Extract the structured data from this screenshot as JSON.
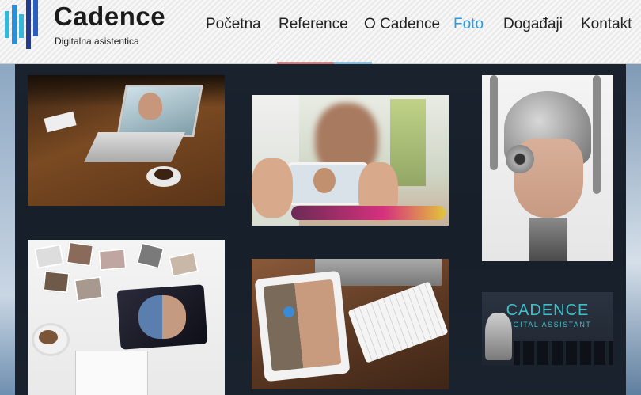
{
  "header": {
    "brand": "Cadence",
    "tagline": "Digitalna asistentica"
  },
  "nav": {
    "items": [
      {
        "label": "Početna",
        "active": false
      },
      {
        "label": "Reference",
        "active": false
      },
      {
        "label": "O Cadence",
        "active": false
      },
      {
        "label": "Foto",
        "active": true
      },
      {
        "label": "Događaji",
        "active": false
      },
      {
        "label": "Kontakt",
        "active": false
      }
    ]
  },
  "colors": {
    "nav_active": "#2b9be6",
    "nav_default": "#222222",
    "panel_bg": "#141c26",
    "cadence_accent": "#3fc0c9"
  },
  "gallery": {
    "thumbnails": [
      {
        "subject": "laptop-video-call"
      },
      {
        "subject": "phone-video-call"
      },
      {
        "subject": "robot-head-portrait"
      },
      {
        "subject": "photos-tablet-desk"
      },
      {
        "subject": "tablet-keyboard-desk"
      },
      {
        "subject": "cadence-logo-card"
      }
    ],
    "logo_card": {
      "title": "CADENCE",
      "subtitle": "DIGITAL ASSISTANT"
    }
  }
}
